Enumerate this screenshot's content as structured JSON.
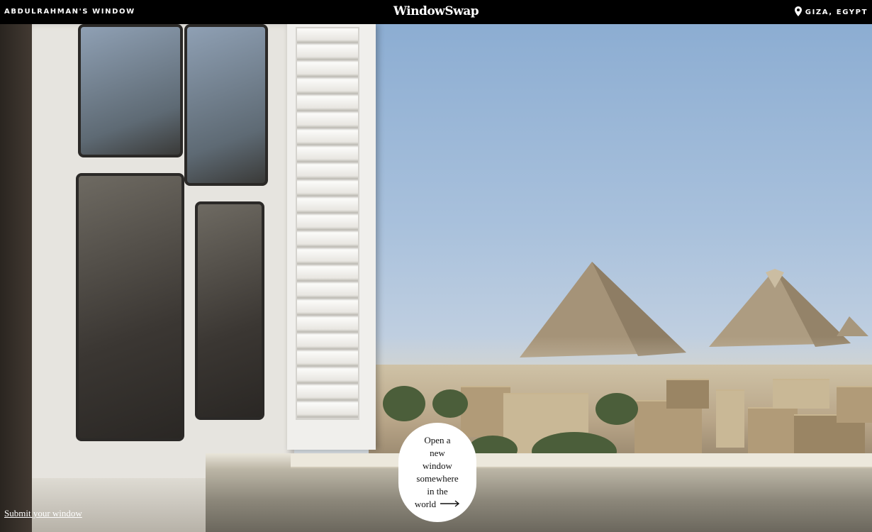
{
  "header": {
    "window_owner": "ABDULRAHMAN'S WINDOW",
    "brand": "WindowSwap",
    "location": "GIZA, EGYPT",
    "location_icon": "map-pin-icon"
  },
  "cta": {
    "text": "Open a\nnew\nwindow\nsomewhere\nin the",
    "last_word": "world",
    "arrow_icon": "arrow-right-icon"
  },
  "footer": {
    "submit_link": "Submit your window"
  },
  "colors": {
    "header_bg": "#000000",
    "cta_bg": "#ffffff",
    "text_light": "#ffffff"
  }
}
